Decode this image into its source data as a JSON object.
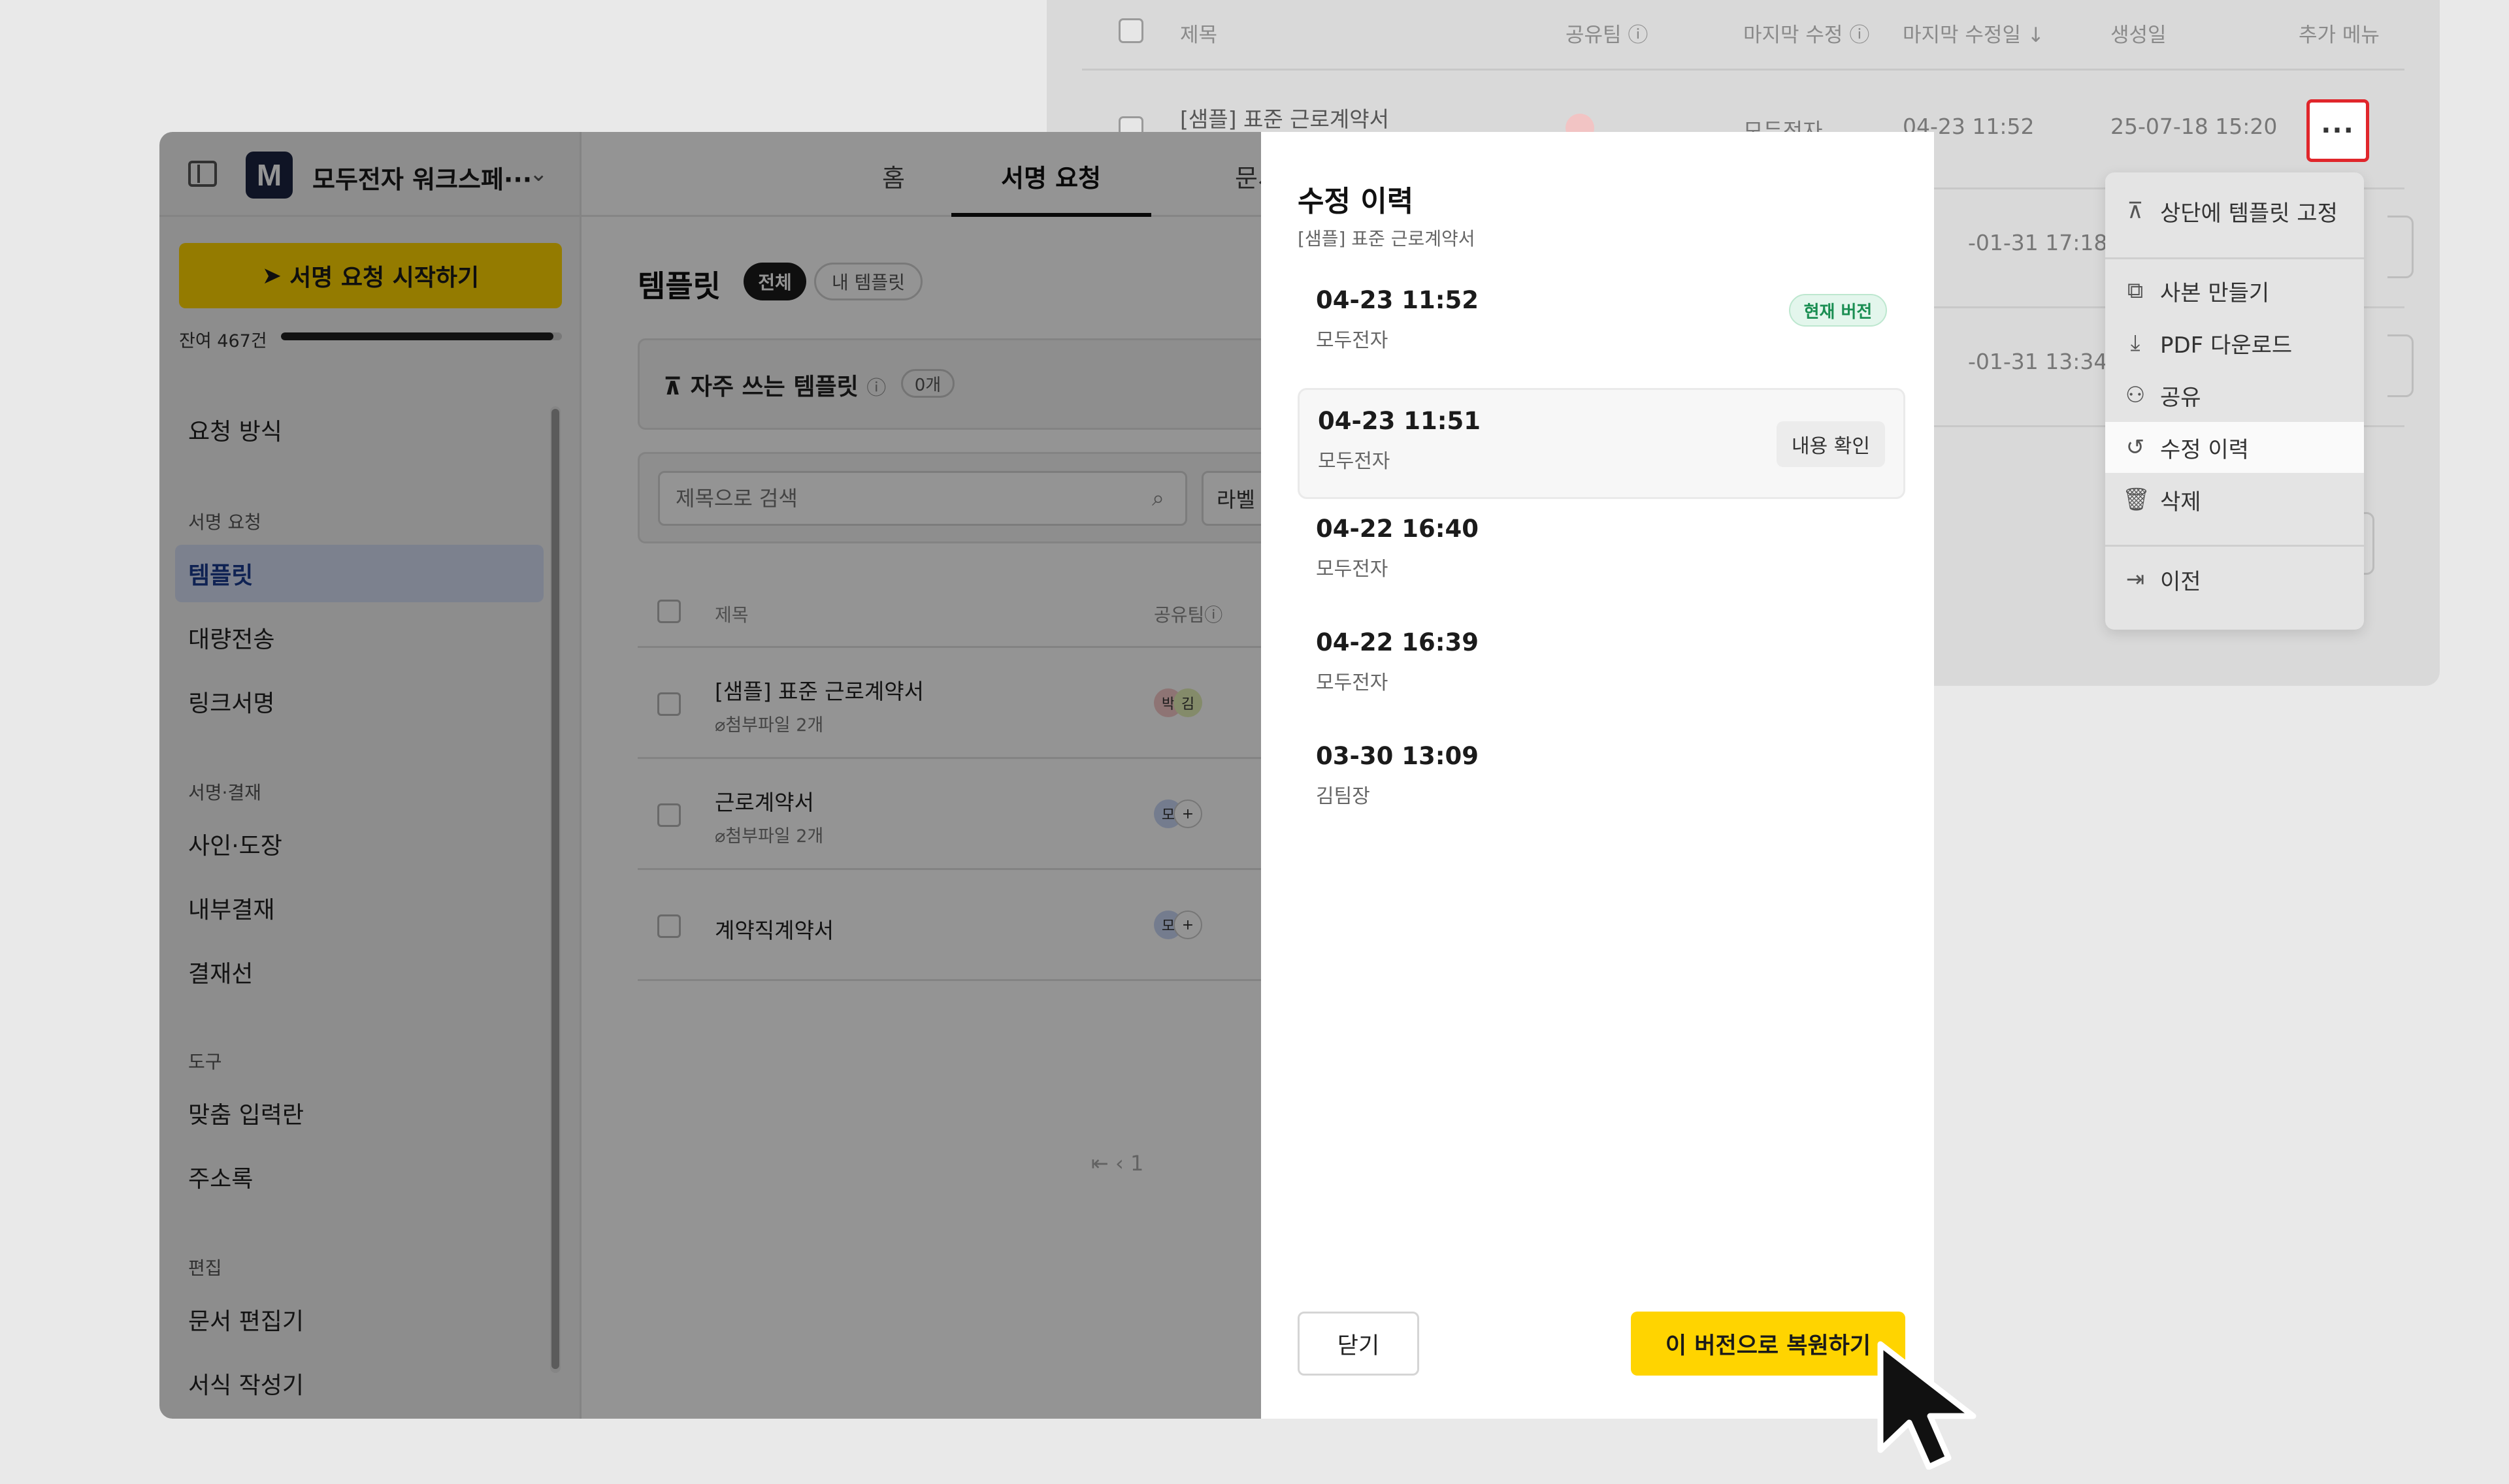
{
  "back_window": {
    "columns": {
      "title": "제목",
      "shared_team": "공유팀",
      "last_modified_by": "마지막 수정",
      "last_modified_date": "마지막 수정일",
      "sort_arrow": "↓",
      "created": "생성일",
      "more_menu": "추가 메뉴"
    },
    "rows": [
      {
        "title": "[샘플] 표준 근로계약서",
        "avatars": "박 김",
        "modifier": "모두전자",
        "modified": "04-23 11:52",
        "created": "25-07-18 15:20"
      },
      {
        "modified": "-01-31 17:18"
      },
      {
        "modified": "-01-31 13:34"
      }
    ],
    "more_button_label": "···",
    "context_menu": [
      {
        "icon": "pin-icon",
        "glyph": "⊼",
        "label": "상단에 템플릿 고정"
      },
      {
        "icon": "copy-icon",
        "glyph": "⧉",
        "label": "사본 만들기"
      },
      {
        "icon": "download-icon",
        "glyph": "⤓",
        "label": "PDF 다운로드"
      },
      {
        "icon": "user-plus-icon",
        "glyph": "⚇",
        "label": "공유"
      },
      {
        "icon": "history-icon",
        "glyph": "↺",
        "label": "수정 이력"
      },
      {
        "icon": "trash-icon",
        "glyph": "🗑",
        "label": "삭제"
      },
      {
        "icon": "move-icon",
        "glyph": "⇥",
        "label": "이전"
      }
    ]
  },
  "sidebar": {
    "workspace_logo": "M",
    "workspace_name": "모두전자 워크스페···",
    "start_button": "서명 요청 시작하기",
    "remaining_label": "잔여 467건",
    "remaining_fraction": 0.97,
    "items": [
      {
        "label": "요청 방식"
      },
      {
        "section": "서명 요청"
      },
      {
        "label": "템플릿",
        "active": true
      },
      {
        "label": "대량전송"
      },
      {
        "label": "링크서명"
      },
      {
        "section": "서명·결재"
      },
      {
        "label": "사인·도장"
      },
      {
        "label": "내부결재"
      },
      {
        "label": "결재선"
      },
      {
        "section": "도구"
      },
      {
        "label": "맞춤 입력란"
      },
      {
        "label": "주소록"
      },
      {
        "section": "편집"
      },
      {
        "label": "문서 편집기"
      },
      {
        "label": "서식 작성기"
      }
    ]
  },
  "topnav": {
    "tabs": [
      "홈",
      "서명 요청",
      "문서"
    ]
  },
  "main": {
    "heading": "템플릿",
    "chip_all": "전체",
    "chip_mine": "내 템플릿",
    "fav_label": "자주 쓰는 템플릿",
    "fav_count": "0개",
    "search_placeholder": "제목으로 검색",
    "label_button": "라벨",
    "col_title": "제목",
    "col_shared": "공유팀",
    "rows": [
      {
        "title": "[샘플] 표준 근로계약서",
        "sub": "첨부파일 2개",
        "av1": "박",
        "av2": "김"
      },
      {
        "title": "근로계약서",
        "sub": "첨부파일 2개",
        "av1": "모",
        "av2": "+"
      },
      {
        "title": "계약직계약서",
        "sub": "",
        "av1": "모",
        "av2": "+"
      }
    ],
    "pager": "⇤     ‹     1"
  },
  "modal": {
    "title": "수정 이력",
    "subtitle": "[샘플] 표준 근로계약서",
    "versions": [
      {
        "time": "04-23 11:52",
        "author": "모두전자",
        "badge": "현재 버전"
      },
      {
        "time": "04-23 11:51",
        "author": "모두전자",
        "action": "내용 확인"
      },
      {
        "time": "04-22 16:40",
        "author": "모두전자"
      },
      {
        "time": "04-22 16:39",
        "author": "모두전자"
      },
      {
        "time": "03-30 13:09",
        "author": "김팀장"
      }
    ],
    "close_button": "닫기",
    "restore_button": "이 버전으로 복원하기"
  },
  "colors": {
    "accent_yellow": "#ffd400",
    "current_badge_green": "#1a8e52",
    "highlight_red": "#e0262b",
    "active_nav_blue": "#1a3c8f"
  }
}
